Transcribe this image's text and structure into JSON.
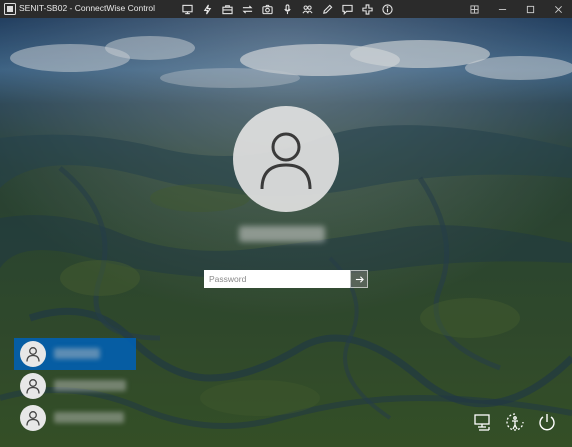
{
  "window": {
    "title": "SENIT-SB02 - ConnectWise Control"
  },
  "toolbar": [
    {
      "name": "monitor-icon"
    },
    {
      "name": "lightning-icon"
    },
    {
      "name": "briefcase-icon"
    },
    {
      "name": "swap-arrows-icon"
    },
    {
      "name": "camera-icon"
    },
    {
      "name": "microphone-icon"
    },
    {
      "name": "group-icon"
    },
    {
      "name": "pencil-icon"
    },
    {
      "name": "chat-icon"
    },
    {
      "name": "plus-icon"
    },
    {
      "name": "info-icon"
    }
  ],
  "window_controls": [
    "fullscreen-icon",
    "minimize-icon",
    "maximize-icon",
    "close-icon"
  ],
  "login": {
    "password_placeholder": "Password"
  },
  "users": [
    {
      "selected": true
    },
    {
      "selected": false
    },
    {
      "selected": false
    }
  ],
  "system_icons": [
    "network-icon",
    "ease-of-access-icon",
    "power-icon"
  ],
  "colors": {
    "titlebar": "#2b2b2b",
    "selected_user": "#0060b4",
    "avatar_bg": "#e1e1e1"
  }
}
